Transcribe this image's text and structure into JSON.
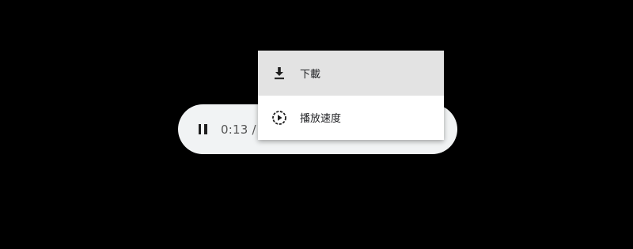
{
  "player": {
    "state": "playing",
    "time_text": "0:13 /",
    "background_color": "#f1f3f4"
  },
  "menu": {
    "items": [
      {
        "label": "下載",
        "icon": "download-icon",
        "highlighted": true
      },
      {
        "label": "播放速度",
        "icon": "playback-speed-icon",
        "highlighted": false
      }
    ]
  },
  "colors": {
    "page_background": "#000000",
    "menu_background": "#ffffff",
    "menu_highlight": "#e3e3e3"
  }
}
